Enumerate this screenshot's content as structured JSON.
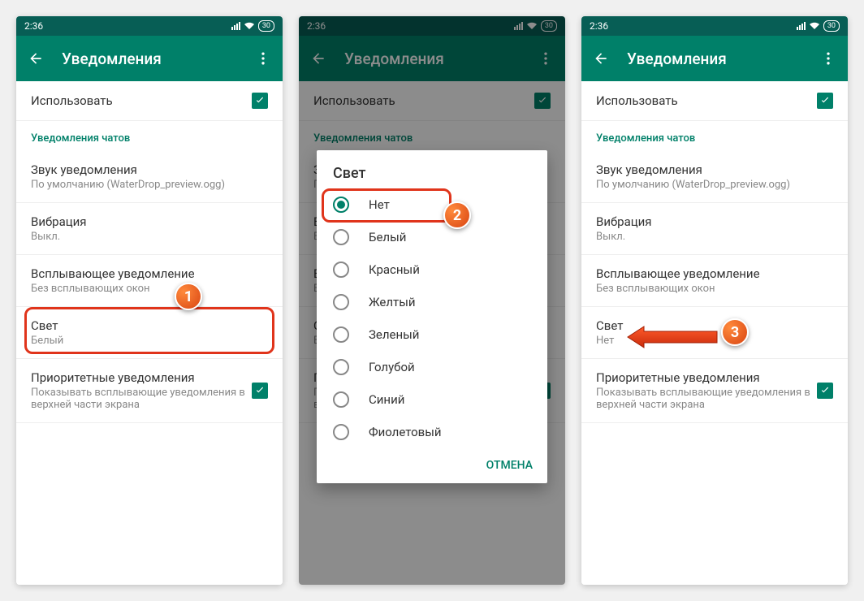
{
  "status": {
    "time": "2:36",
    "battery": "30"
  },
  "appbar": {
    "title": "Уведомления"
  },
  "rows": {
    "use": "Использовать",
    "section": "Уведомления чатов",
    "sound_title": "Звук уведомления",
    "sound_sub": "По умолчанию (WaterDrop_preview.ogg)",
    "vibration_title": "Вибрация",
    "vibration_sub": "Выкл.",
    "popup_title": "Всплывающее уведомление",
    "popup_sub": "Без всплывающих окон",
    "light_title": "Свет",
    "light_sub_before": "Белый",
    "light_sub_after": "Нет",
    "priority_title": "Приоритетные уведомления",
    "priority_sub": "Показывать всплывающие уведомления в верхней части экрана"
  },
  "dialog": {
    "title": "Свет",
    "options": [
      "Нет",
      "Белый",
      "Красный",
      "Желтый",
      "Зеленый",
      "Голубой",
      "Синий",
      "Фиолетовый"
    ],
    "selected_index": 0,
    "cancel": "ОТМЕНА"
  },
  "callouts": {
    "one": "1",
    "two": "2",
    "three": "3"
  }
}
